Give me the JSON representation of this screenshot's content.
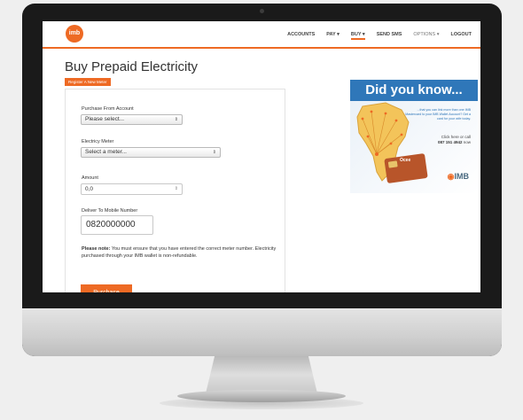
{
  "nav": {
    "logo": "imb",
    "items": [
      {
        "label": "ACCOUNTS",
        "name": "nav-accounts",
        "style": ""
      },
      {
        "label": "PAY ▾",
        "name": "nav-pay",
        "style": ""
      },
      {
        "label": "BUY ▾",
        "name": "nav-buy",
        "style": "active"
      },
      {
        "label": "SEND SMS",
        "name": "nav-send-sms",
        "style": ""
      },
      {
        "label": "OPTIONS ▾",
        "name": "nav-options",
        "style": "light"
      },
      {
        "label": "LOGOUT",
        "name": "nav-logout",
        "style": ""
      }
    ]
  },
  "page": {
    "title": "Buy Prepaid Electricity",
    "register_label": "Register A New Meter"
  },
  "form": {
    "account_label": "Purchase From Account",
    "account_value": "Please select...",
    "meter_label": "Electricy Meter",
    "meter_value": "Select a meter...",
    "amount_label": "Amount",
    "amount_value": "0,0",
    "mobile_label": "Deliver To Mobile Number",
    "mobile_value": "0820000000",
    "note_bold": "Please note:",
    "note_text": " You must ensure that you have entered the correct meter number. Electricity purchased through your IMB wallet is non-refundable.",
    "purchase_label": "Purchase"
  },
  "ad": {
    "headline": "Did you know...",
    "body": "...that you can link more than one IMB Mastercard to your IMB Wallet Account? Get a card for your wife today.",
    "call_prefix": "Click here or call",
    "phone": "087 151 4942",
    "call_suffix": "now",
    "card_label": "Ocee",
    "brand": "IMB",
    "colors": {
      "accent": "#ee6a24",
      "blue": "#2f77b9"
    }
  }
}
